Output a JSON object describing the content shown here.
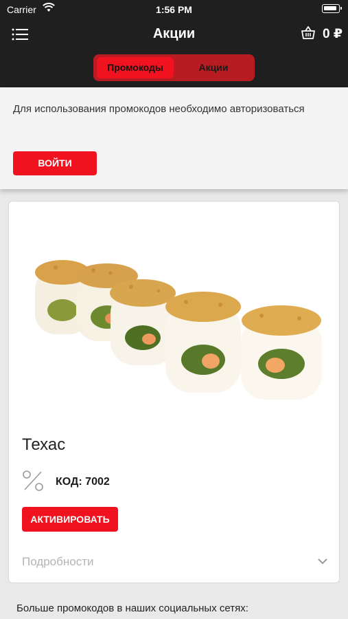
{
  "status_bar": {
    "carrier": "Carrier",
    "time": "1:56 PM"
  },
  "nav": {
    "title": "Акции",
    "cart_total": "0 ₽"
  },
  "segments": {
    "left": "Промокоды",
    "right": "Акции",
    "active": "left"
  },
  "auth": {
    "message": "Для использования промокодов необходимо авторизоваться",
    "login_label": "ВОЙТИ"
  },
  "promo": {
    "title": "Техас",
    "code": "КОД: 7002",
    "activate_label": "АКТИВИРОВАТЬ",
    "details_label": "Подробности",
    "image_icon": "sushi-rolls-image"
  },
  "social": {
    "text": "Больше промокодов в наших социальных сетях:"
  },
  "colors": {
    "accent": "#f0131f",
    "accent_dark": "#b71c22",
    "topbar": "#1f1f1f"
  }
}
